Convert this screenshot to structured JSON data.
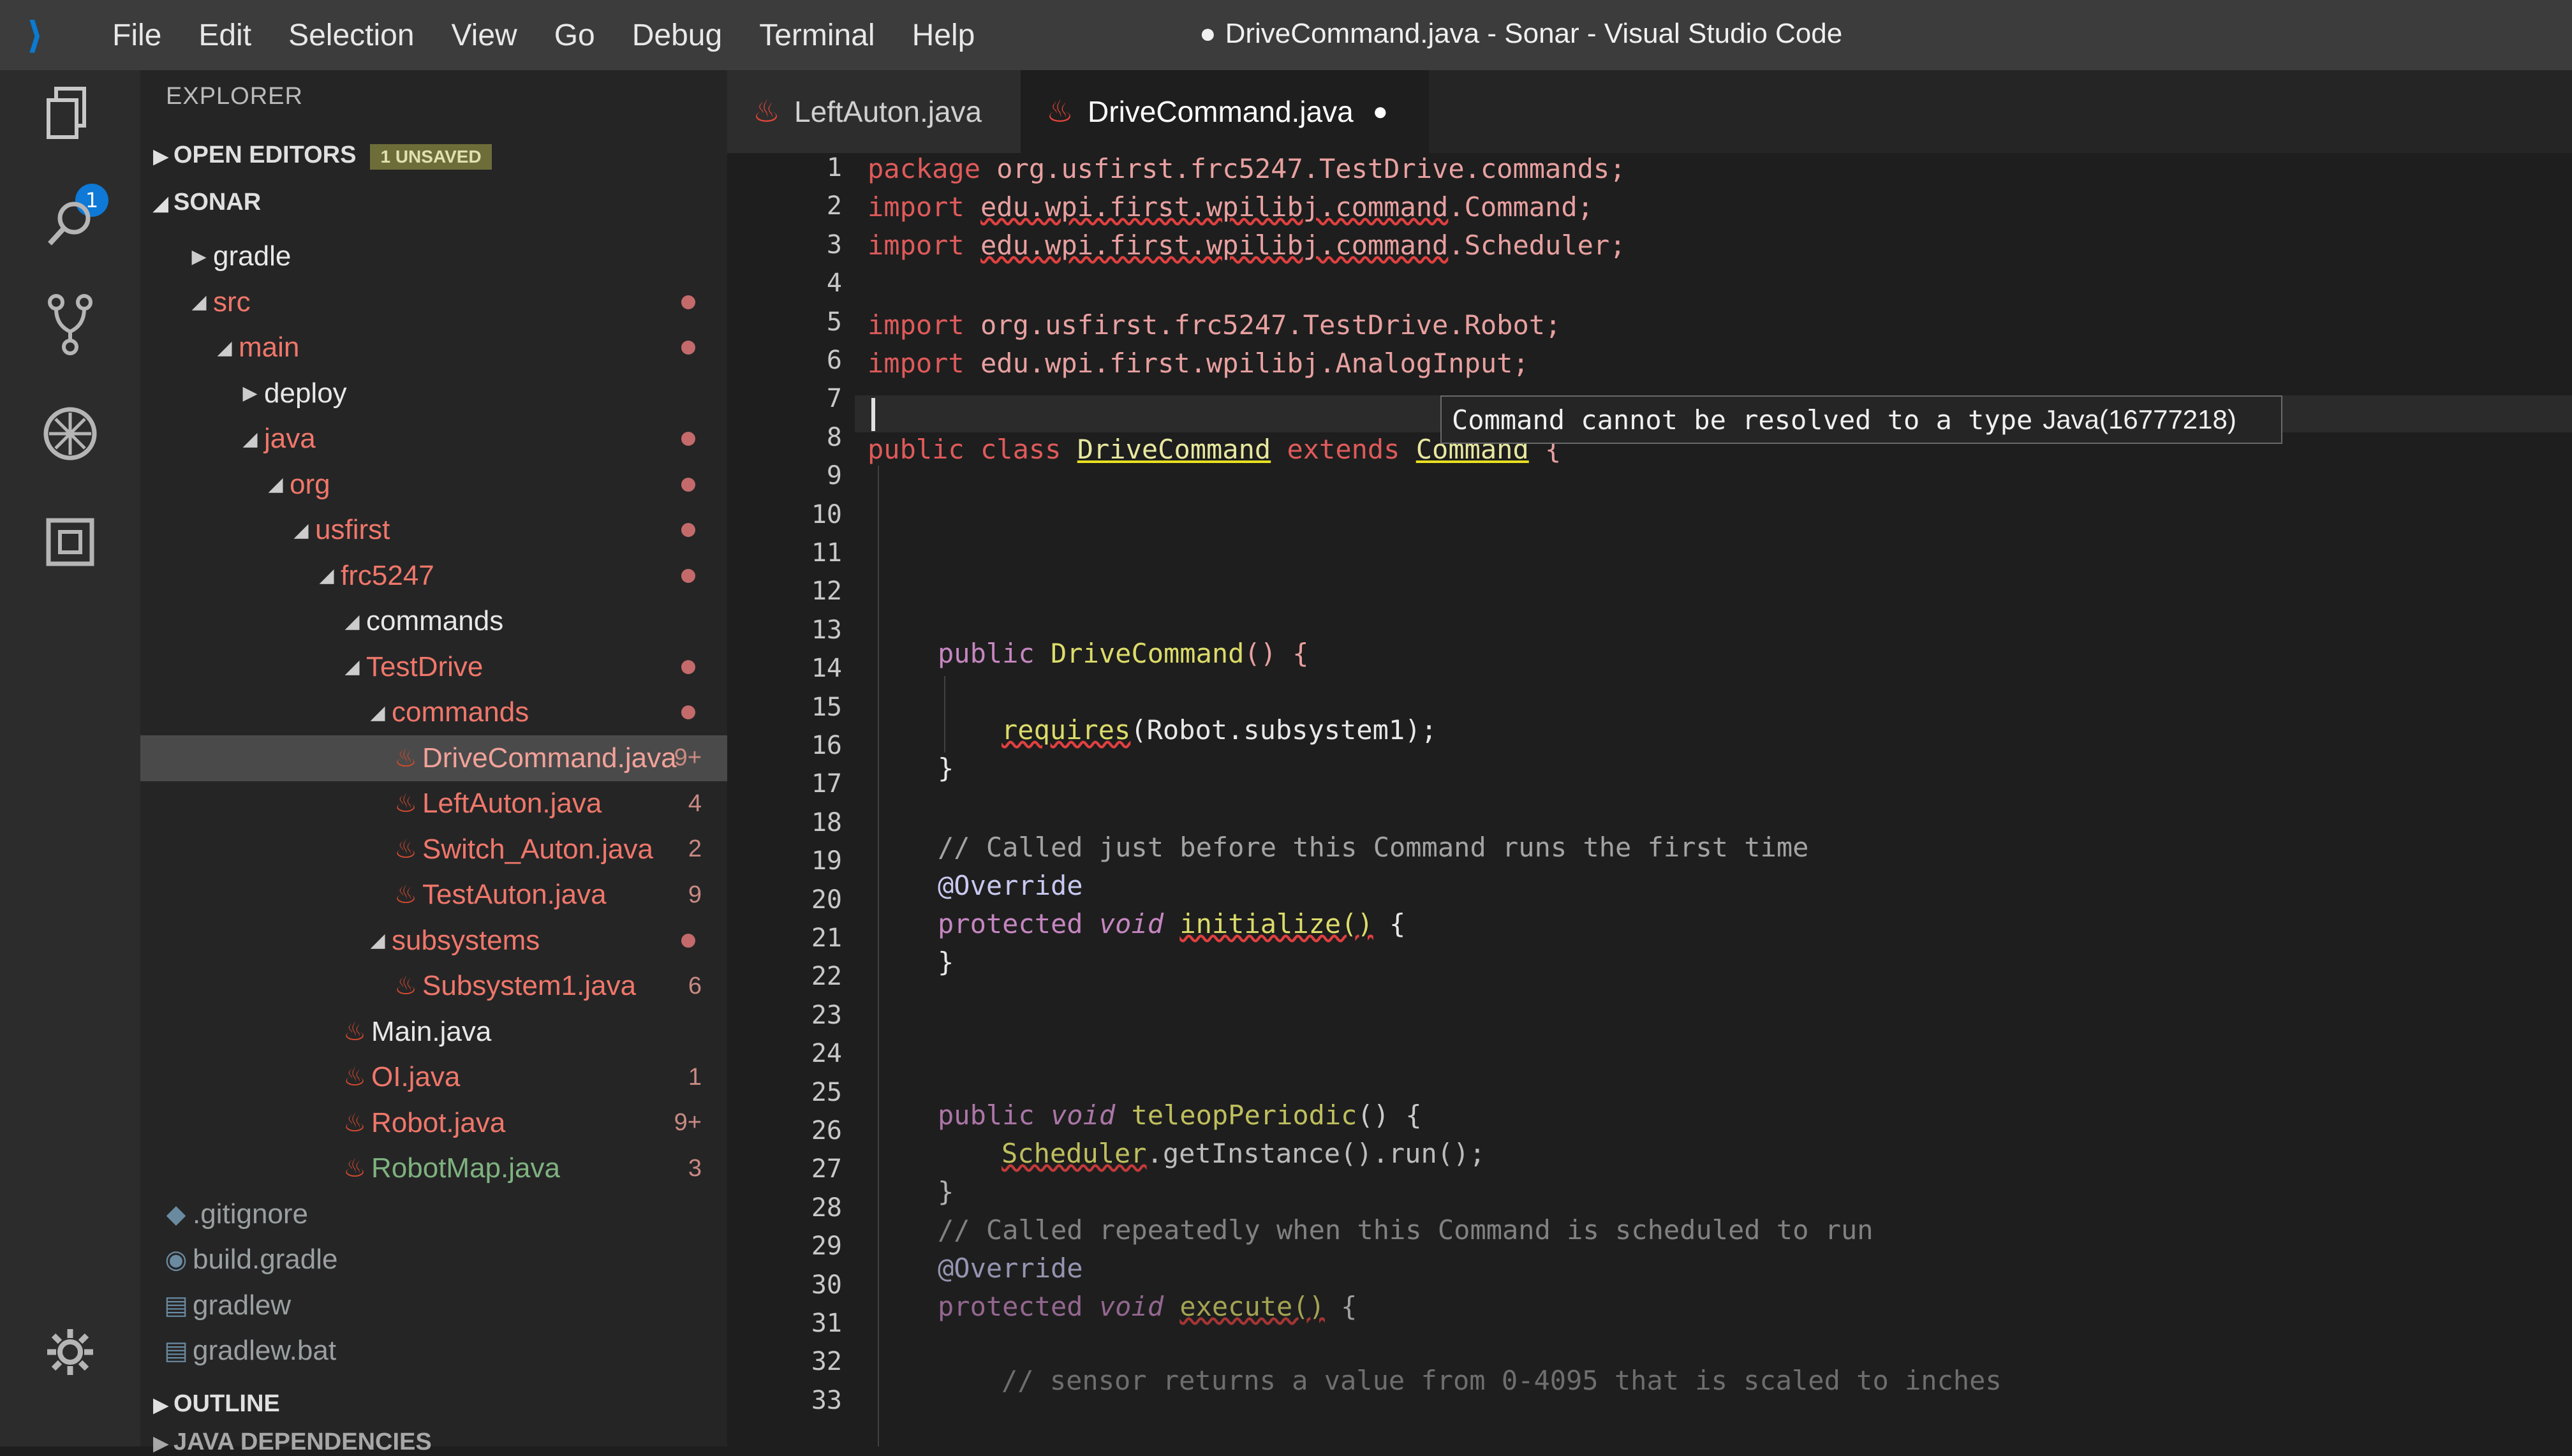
{
  "window": {
    "title": "DriveCommand.java - Sonar - Visual Studio Code",
    "dirty_marker": "●"
  },
  "menu": [
    "File",
    "Edit",
    "Selection",
    "View",
    "Go",
    "Debug",
    "Terminal",
    "Help"
  ],
  "activity_bar": {
    "explorer_badge": "1",
    "icons": [
      "files-icon",
      "search-icon",
      "source-control-icon",
      "debug-icon",
      "extensions-icon",
      "gear-icon"
    ]
  },
  "sidebar": {
    "title": "EXPLORER",
    "open_editors_label": "OPEN EDITORS",
    "unsaved_badge": "1 UNSAVED",
    "project_label": "SONAR",
    "tree": [
      {
        "label": "gradle",
        "twisty": "▶",
        "style": "norm",
        "deco": ""
      },
      {
        "label": "src",
        "twisty": "◢",
        "style": "err",
        "deco": "dot"
      },
      {
        "label": "main",
        "twisty": "◢",
        "style": "err",
        "deco": "dot"
      },
      {
        "label": "deploy",
        "twisty": "▶",
        "style": "norm",
        "deco": ""
      },
      {
        "label": "java",
        "twisty": "◢",
        "style": "err",
        "deco": "dot"
      },
      {
        "label": "org",
        "twisty": "◢",
        "style": "err",
        "deco": "dot"
      },
      {
        "label": "usfirst",
        "twisty": "◢",
        "style": "err",
        "deco": "dot"
      },
      {
        "label": "frc5247",
        "twisty": "◢",
        "style": "err",
        "deco": "dot"
      },
      {
        "label": "commands",
        "twisty": "◢",
        "style": "norm",
        "deco": ""
      },
      {
        "label": "TestDrive",
        "twisty": "◢",
        "style": "err",
        "deco": "dot"
      },
      {
        "label": "commands",
        "twisty": "◢",
        "style": "err",
        "deco": "dot"
      },
      {
        "label": "DriveCommand.java",
        "twisty": "",
        "style": "err",
        "deco": "9+",
        "selected": true
      },
      {
        "label": "LeftAuton.java",
        "twisty": "",
        "style": "err",
        "deco": "4"
      },
      {
        "label": "Switch_Auton.java",
        "twisty": "",
        "style": "err",
        "deco": "2"
      },
      {
        "label": "TestAuton.java",
        "twisty": "",
        "style": "err",
        "deco": "9"
      },
      {
        "label": "subsystems",
        "twisty": "◢",
        "style": "err",
        "deco": "dot"
      },
      {
        "label": "Subsystem1.java",
        "twisty": "",
        "style": "err",
        "deco": "6"
      },
      {
        "label": "Main.java",
        "twisty": "",
        "style": "norm",
        "deco": ""
      },
      {
        "label": "OI.java",
        "twisty": "",
        "style": "err",
        "deco": "1"
      },
      {
        "label": "Robot.java",
        "twisty": "",
        "style": "err",
        "deco": "9+"
      },
      {
        "label": "RobotMap.java",
        "twisty": "",
        "style": "green",
        "deco": "3"
      },
      {
        "label": ".gitignore",
        "twisty": "",
        "style": "dim",
        "deco": ""
      },
      {
        "label": "build.gradle",
        "twisty": "",
        "style": "dim",
        "deco": ""
      },
      {
        "label": "gradlew",
        "twisty": "",
        "style": "dim",
        "deco": ""
      },
      {
        "label": "gradlew.bat",
        "twisty": "",
        "style": "dim",
        "deco": ""
      }
    ],
    "outline_label": "OUTLINE",
    "java_deps_label": "JAVA DEPENDENCIES"
  },
  "tabs": [
    {
      "label": "LeftAuton.java",
      "active": false
    },
    {
      "label": "DriveCommand.java",
      "active": true,
      "dirty": "●"
    }
  ],
  "hover": {
    "message": "Command cannot be resolved to a type",
    "source": "Java(16777218)"
  },
  "code": {
    "line_numbers": [
      "1",
      "2",
      "3",
      "4",
      "5",
      "6",
      "7",
      "8",
      "9",
      "10",
      "11",
      "12",
      "13",
      "14",
      "15",
      "16",
      "17",
      "18",
      "19",
      "20",
      "21",
      "22",
      "23",
      "24",
      "25",
      "26",
      "27",
      "28",
      "29",
      "30",
      "31",
      "32",
      "33"
    ],
    "l1": {
      "a": "package",
      "b": " org.usfirst.frc5247.TestDrive.commands;"
    },
    "l2": {
      "a": "import",
      "b": "edu.wpi.first.wpilibj.command",
      "c": ".Command;"
    },
    "l3": {
      "a": "import",
      "b": "edu.wpi.first.wpilibj.command",
      "c": ".Scheduler;"
    },
    "l5": {
      "a": "import",
      "b": " org.usfirst.frc5247.TestDrive.Robot;"
    },
    "l6": {
      "a": "import",
      "b": " edu.wpi.first.wpilibj.AnalogInput;"
    },
    "l8": {
      "a": "public class ",
      "b": "DriveCommand",
      "c": " extends ",
      "d": "Command",
      "e": " {"
    },
    "l13": {
      "a": "public ",
      "b": "DriveCommand",
      "c": "() {"
    },
    "l15": {
      "a": "requires",
      "b": "(Robot.subsystem1);"
    },
    "l16": "}",
    "l18": "// Called just before this Command runs the first time",
    "l19": "@Override",
    "l20": {
      "a": "protected ",
      "b": "void ",
      "c": "initialize()",
      "d": " {"
    },
    "l21": "}",
    "l25": {
      "a": "public ",
      "b": "void ",
      "c": "teleopPeriodic",
      "d": "() {"
    },
    "l26": {
      "a": "Scheduler",
      "b": ".getInstance().run();"
    },
    "l27": "}",
    "l28": "// Called repeatedly when this Command is scheduled to run",
    "l29": "@Override",
    "l30": {
      "a": "protected ",
      "b": "void ",
      "c": "execute()",
      "d": " {"
    },
    "l32": "// sensor returns a value from 0-4095 that is scaled to inches"
  }
}
